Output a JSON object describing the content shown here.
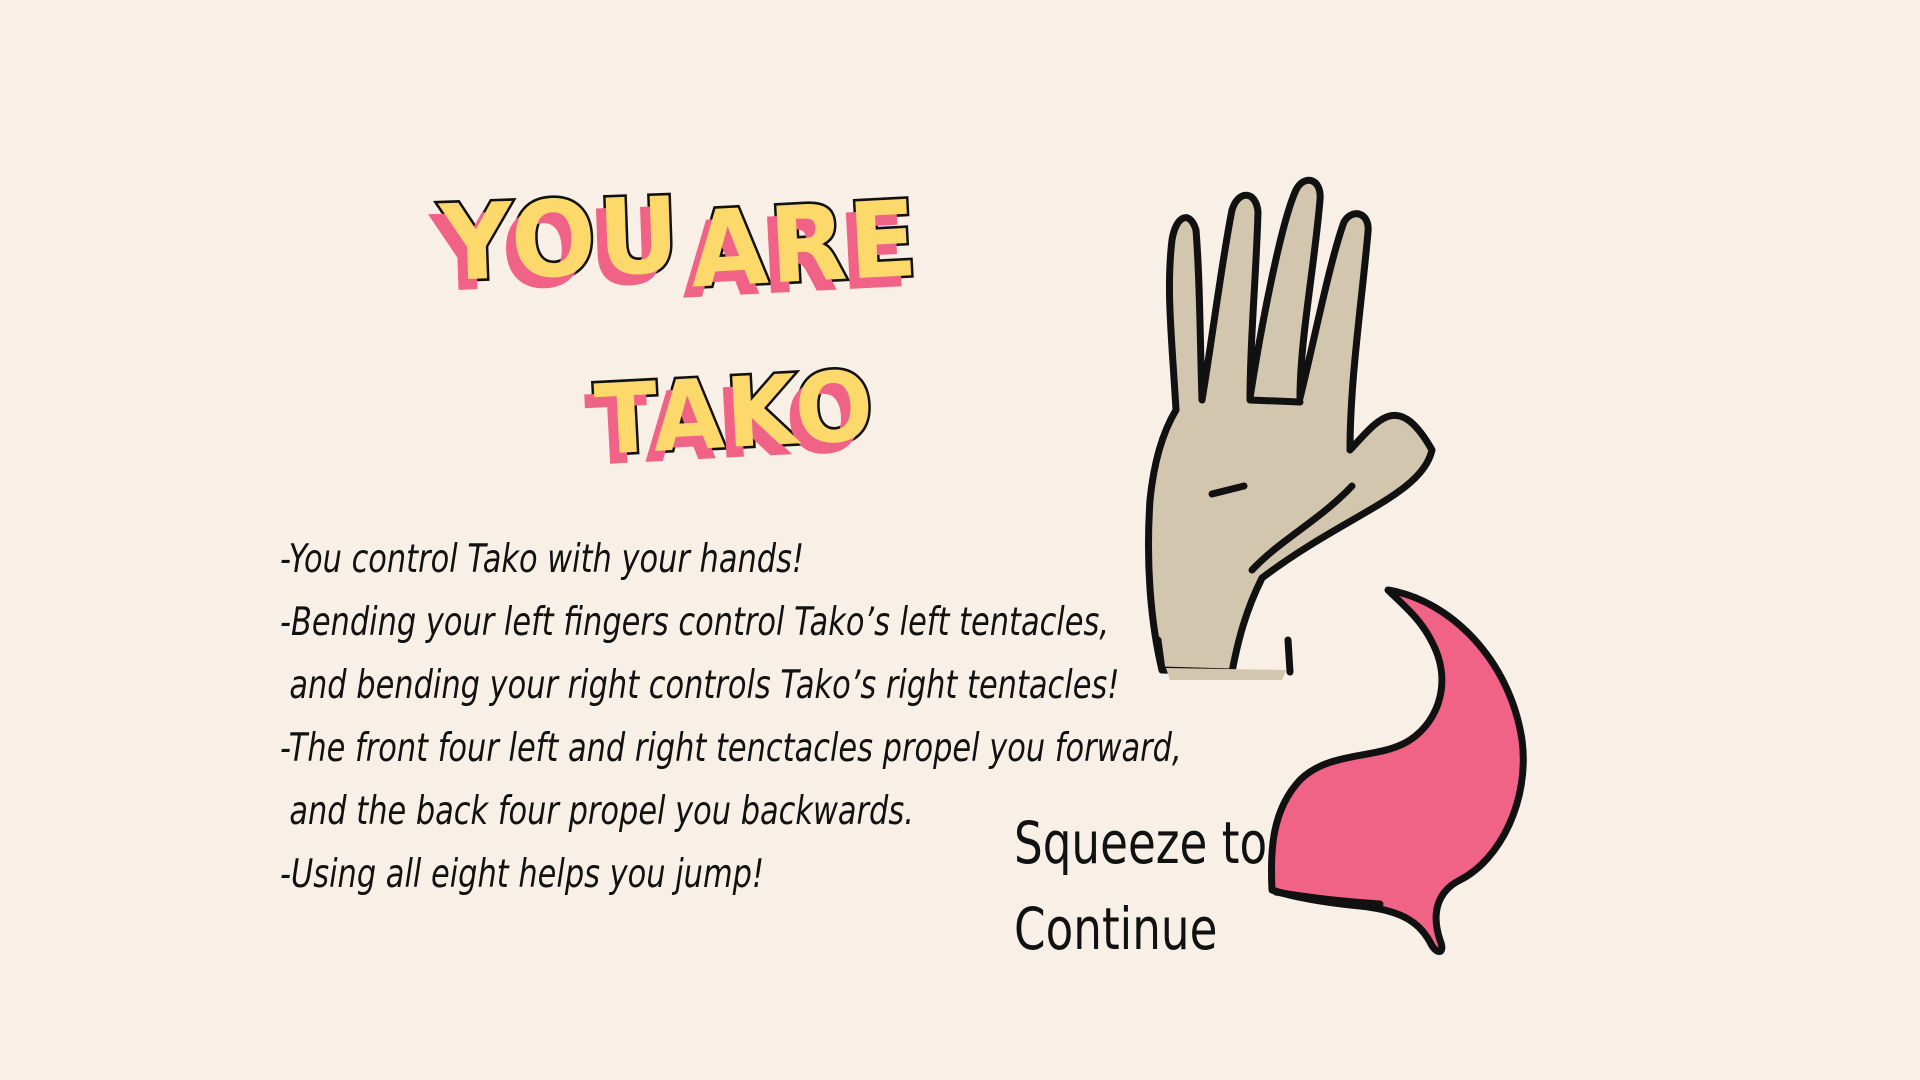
{
  "title": {
    "word1": "YOU",
    "word2": "ARE",
    "word3": "TAKO"
  },
  "instructions": [
    "-You control Tako with your hands!",
    "-Bending your left fingers control Tako’s left tentacles,",
    "and bending your right controls Tako’s right tentacles!",
    "-The front four left and right tenctacles propel you forward,",
    "and the back four propel you backwards.",
    "-Using all eight helps you jump!"
  ],
  "continue_prompt": {
    "line1": "Squeeze to",
    "line2": "Continue"
  },
  "colors": {
    "background": "#f8f0e6",
    "title_fill": "#fdd86a",
    "title_shadow": "#f06386",
    "hand": "#d3c6ae",
    "tentacle": "#f06386",
    "outline": "#111111"
  },
  "icons": {
    "hand": "open-hand-icon",
    "tentacle": "tentacle-icon"
  }
}
